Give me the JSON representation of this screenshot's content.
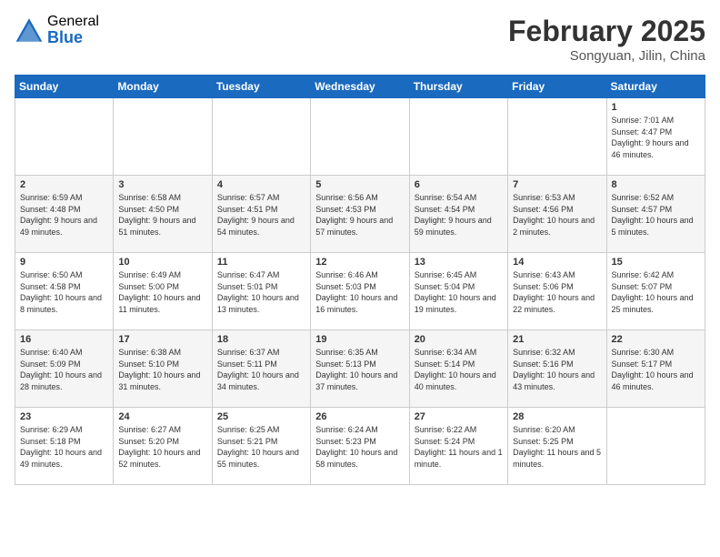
{
  "logo": {
    "general": "General",
    "blue": "Blue"
  },
  "title": "February 2025",
  "subtitle": "Songyuan, Jilin, China",
  "days_of_week": [
    "Sunday",
    "Monday",
    "Tuesday",
    "Wednesday",
    "Thursday",
    "Friday",
    "Saturday"
  ],
  "weeks": [
    [
      {
        "day": "",
        "text": ""
      },
      {
        "day": "",
        "text": ""
      },
      {
        "day": "",
        "text": ""
      },
      {
        "day": "",
        "text": ""
      },
      {
        "day": "",
        "text": ""
      },
      {
        "day": "",
        "text": ""
      },
      {
        "day": "1",
        "text": "Sunrise: 7:01 AM\nSunset: 4:47 PM\nDaylight: 9 hours and 46 minutes."
      }
    ],
    [
      {
        "day": "2",
        "text": "Sunrise: 6:59 AM\nSunset: 4:48 PM\nDaylight: 9 hours and 49 minutes."
      },
      {
        "day": "3",
        "text": "Sunrise: 6:58 AM\nSunset: 4:50 PM\nDaylight: 9 hours and 51 minutes."
      },
      {
        "day": "4",
        "text": "Sunrise: 6:57 AM\nSunset: 4:51 PM\nDaylight: 9 hours and 54 minutes."
      },
      {
        "day": "5",
        "text": "Sunrise: 6:56 AM\nSunset: 4:53 PM\nDaylight: 9 hours and 57 minutes."
      },
      {
        "day": "6",
        "text": "Sunrise: 6:54 AM\nSunset: 4:54 PM\nDaylight: 9 hours and 59 minutes."
      },
      {
        "day": "7",
        "text": "Sunrise: 6:53 AM\nSunset: 4:56 PM\nDaylight: 10 hours and 2 minutes."
      },
      {
        "day": "8",
        "text": "Sunrise: 6:52 AM\nSunset: 4:57 PM\nDaylight: 10 hours and 5 minutes."
      }
    ],
    [
      {
        "day": "9",
        "text": "Sunrise: 6:50 AM\nSunset: 4:58 PM\nDaylight: 10 hours and 8 minutes."
      },
      {
        "day": "10",
        "text": "Sunrise: 6:49 AM\nSunset: 5:00 PM\nDaylight: 10 hours and 11 minutes."
      },
      {
        "day": "11",
        "text": "Sunrise: 6:47 AM\nSunset: 5:01 PM\nDaylight: 10 hours and 13 minutes."
      },
      {
        "day": "12",
        "text": "Sunrise: 6:46 AM\nSunset: 5:03 PM\nDaylight: 10 hours and 16 minutes."
      },
      {
        "day": "13",
        "text": "Sunrise: 6:45 AM\nSunset: 5:04 PM\nDaylight: 10 hours and 19 minutes."
      },
      {
        "day": "14",
        "text": "Sunrise: 6:43 AM\nSunset: 5:06 PM\nDaylight: 10 hours and 22 minutes."
      },
      {
        "day": "15",
        "text": "Sunrise: 6:42 AM\nSunset: 5:07 PM\nDaylight: 10 hours and 25 minutes."
      }
    ],
    [
      {
        "day": "16",
        "text": "Sunrise: 6:40 AM\nSunset: 5:09 PM\nDaylight: 10 hours and 28 minutes."
      },
      {
        "day": "17",
        "text": "Sunrise: 6:38 AM\nSunset: 5:10 PM\nDaylight: 10 hours and 31 minutes."
      },
      {
        "day": "18",
        "text": "Sunrise: 6:37 AM\nSunset: 5:11 PM\nDaylight: 10 hours and 34 minutes."
      },
      {
        "day": "19",
        "text": "Sunrise: 6:35 AM\nSunset: 5:13 PM\nDaylight: 10 hours and 37 minutes."
      },
      {
        "day": "20",
        "text": "Sunrise: 6:34 AM\nSunset: 5:14 PM\nDaylight: 10 hours and 40 minutes."
      },
      {
        "day": "21",
        "text": "Sunrise: 6:32 AM\nSunset: 5:16 PM\nDaylight: 10 hours and 43 minutes."
      },
      {
        "day": "22",
        "text": "Sunrise: 6:30 AM\nSunset: 5:17 PM\nDaylight: 10 hours and 46 minutes."
      }
    ],
    [
      {
        "day": "23",
        "text": "Sunrise: 6:29 AM\nSunset: 5:18 PM\nDaylight: 10 hours and 49 minutes."
      },
      {
        "day": "24",
        "text": "Sunrise: 6:27 AM\nSunset: 5:20 PM\nDaylight: 10 hours and 52 minutes."
      },
      {
        "day": "25",
        "text": "Sunrise: 6:25 AM\nSunset: 5:21 PM\nDaylight: 10 hours and 55 minutes."
      },
      {
        "day": "26",
        "text": "Sunrise: 6:24 AM\nSunset: 5:23 PM\nDaylight: 10 hours and 58 minutes."
      },
      {
        "day": "27",
        "text": "Sunrise: 6:22 AM\nSunset: 5:24 PM\nDaylight: 11 hours and 1 minute."
      },
      {
        "day": "28",
        "text": "Sunrise: 6:20 AM\nSunset: 5:25 PM\nDaylight: 11 hours and 5 minutes."
      },
      {
        "day": "",
        "text": ""
      }
    ]
  ]
}
